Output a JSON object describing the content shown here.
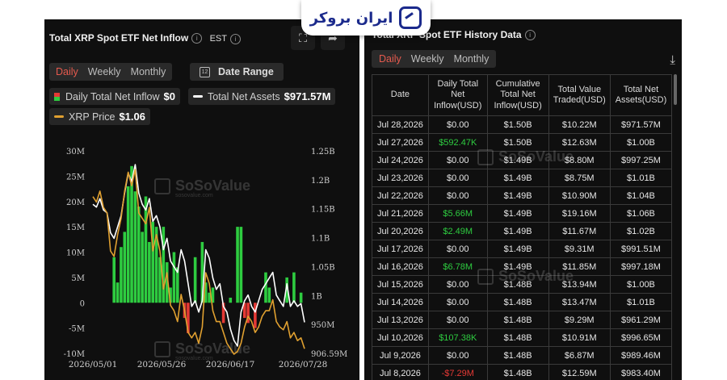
{
  "brand": {
    "name": "ایران بروکر"
  },
  "left": {
    "title": "Total XRP Spot ETF Net Inflow",
    "timezone": "EST",
    "tabs": [
      "Daily",
      "Weekly",
      "Monthly"
    ],
    "active_tab": "Daily",
    "date_range_label": "Date Range",
    "legend": {
      "inflow_label": "Daily Total Net Inflow",
      "inflow_value": "$0",
      "assets_label": "Total Net Assets",
      "assets_value": "$971.57M",
      "price_label": "XRP Price",
      "price_value": "$1.06"
    },
    "watermark": "SoSoValue",
    "watermark_sub": "sosovalue.com"
  },
  "right": {
    "title": "Total XRP Spot ETF History Data",
    "tabs": [
      "Daily",
      "Weekly",
      "Monthly"
    ],
    "active_tab": "Daily",
    "columns": [
      "Date",
      "Daily Total Net Inflow(USD)",
      "Cumulative Total Net Inflow(USD)",
      "Total Value Traded(USD)",
      "Total Net Assets(USD)"
    ],
    "rows": [
      [
        "Jul 28,2026",
        "$0.00",
        "$1.50B",
        "$10.22M",
        "$971.57M"
      ],
      [
        "Jul 27,2026",
        "$592.47K",
        "$1.50B",
        "$12.63M",
        "$1.00B"
      ],
      [
        "Jul 24,2026",
        "$0.00",
        "$1.49B",
        "$8.80M",
        "$997.25M"
      ],
      [
        "Jul 23,2026",
        "$0.00",
        "$1.49B",
        "$8.75M",
        "$1.01B"
      ],
      [
        "Jul 22,2026",
        "$0.00",
        "$1.49B",
        "$10.90M",
        "$1.04B"
      ],
      [
        "Jul 21,2026",
        "$5.66M",
        "$1.49B",
        "$19.16M",
        "$1.06B"
      ],
      [
        "Jul 20,2026",
        "$2.49M",
        "$1.49B",
        "$11.67M",
        "$1.02B"
      ],
      [
        "Jul 17,2026",
        "$0.00",
        "$1.49B",
        "$9.31M",
        "$991.51M"
      ],
      [
        "Jul 16,2026",
        "$6.78M",
        "$1.49B",
        "$11.85M",
        "$997.18M"
      ],
      [
        "Jul 15,2026",
        "$0.00",
        "$1.48B",
        "$13.94M",
        "$1.00B"
      ],
      [
        "Jul 14,2026",
        "$0.00",
        "$1.48B",
        "$13.47M",
        "$1.01B"
      ],
      [
        "Jul 13,2026",
        "$0.00",
        "$1.48B",
        "$9.29M",
        "$961.29M"
      ],
      [
        "Jul 10,2026",
        "$107.38K",
        "$1.48B",
        "$10.91M",
        "$996.65M"
      ],
      [
        "Jul 9,2026",
        "$0.00",
        "$1.48B",
        "$6.87M",
        "$989.46M"
      ],
      [
        "Jul 8,2026",
        "-$7.29M",
        "$1.48B",
        "$12.59M",
        "$983.40M"
      ]
    ],
    "watermark": "SoSoValue"
  },
  "chart_data": {
    "type": "bar",
    "left_axis": {
      "ticks": [
        30,
        25,
        20,
        15,
        10,
        5,
        0,
        -5,
        -10
      ],
      "labels": [
        "30M",
        "25M",
        "20M",
        "15M",
        "10M",
        "5M",
        "0",
        "-5M",
        "-10M"
      ],
      "ylim": [
        -10,
        30
      ]
    },
    "right_axis": {
      "labels": [
        "1.25B",
        "1.2B",
        "1.15B",
        "1.1B",
        "1.05B",
        "1B",
        "950M",
        "906.59M"
      ],
      "ylim": [
        906.59,
        1250
      ]
    },
    "x_labels": [
      "2026/05/01",
      "2026/05/26",
      "2026/06/17",
      "2026/07/28"
    ],
    "inflow_values": [
      0,
      0,
      0,
      0,
      0,
      0,
      9,
      4,
      11,
      14,
      23,
      27,
      22,
      19,
      14,
      21,
      12,
      16,
      15,
      9,
      15,
      8,
      3,
      10,
      7,
      0,
      -3,
      -6,
      0,
      9,
      0,
      12,
      4,
      2,
      3,
      0,
      0,
      -4,
      0,
      1,
      0,
      15,
      15,
      -3,
      -4,
      0,
      -5,
      0,
      0,
      6,
      3,
      0,
      0,
      0,
      0,
      5,
      0,
      6,
      0,
      2,
      0
    ],
    "series": [
      {
        "name": "Total Net Assets",
        "color": "#ffffff",
        "values": [
          1180,
          1175,
          1190,
          1170,
          1165,
          1130,
          1120,
          1140,
          1160,
          1200,
          1235,
          1220,
          1250,
          1200,
          1180,
          1170,
          1190,
          1150,
          1160,
          1140,
          1100,
          1120,
          1080,
          1070,
          1060,
          1100,
          1080,
          1040,
          1000,
          1010,
          990,
          1010,
          1100,
          1085,
          1050,
          1030,
          1040,
          1000,
          990,
          960,
          940,
          930,
          990,
          1010,
          1020,
          1000,
          990,
          1010,
          1030,
          1040,
          1050,
          1060,
          1020,
          1010,
          1000,
          1040,
          1000,
          1010,
          1000,
          1005,
          972
        ]
      },
      {
        "name": "XRP Price",
        "color": "#e0a030",
        "values": [
          1.2,
          1.19,
          1.21,
          1.18,
          1.17,
          1.1,
          1.09,
          1.13,
          1.16,
          1.21,
          1.245,
          1.22,
          1.25,
          1.17,
          1.16,
          1.15,
          1.18,
          1.1,
          1.13,
          1.1,
          1.03,
          1.06,
          1.0,
          0.99,
          0.97,
          1.02,
          0.99,
          0.95,
          0.94,
          0.95,
          0.93,
          0.96,
          1.06,
          1.04,
          0.99,
          0.97,
          0.97,
          0.95,
          0.93,
          0.92,
          0.91,
          0.915,
          0.93,
          0.96,
          0.98,
          0.97,
          0.95,
          0.96,
          0.98,
          0.99,
          0.99,
          1.01,
          0.97,
          0.96,
          0.955,
          0.97,
          0.94,
          0.95,
          0.935,
          0.94,
          0.92
        ]
      }
    ]
  }
}
